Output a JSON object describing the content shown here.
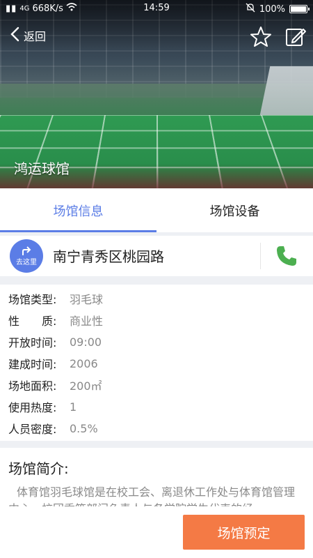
{
  "status_bar": {
    "network": "4G",
    "speed": "668K/s",
    "time": "14:59",
    "battery": "100%"
  },
  "header": {
    "back_label": "返回",
    "venue_name": "鸿运球馆"
  },
  "tabs": [
    {
      "label": "场馆信息",
      "active": true
    },
    {
      "label": "场馆设备",
      "active": false
    }
  ],
  "address": {
    "go_label": "去这里",
    "text": "南宁青秀区桃园路"
  },
  "details": [
    {
      "key": "场馆类型:",
      "value": "羽毛球"
    },
    {
      "key": "性　　质:",
      "value": "商业性"
    },
    {
      "key": "开放时间:",
      "value": "09:00"
    },
    {
      "key": "建成时间:",
      "value": "2006"
    },
    {
      "key": "场地面积:",
      "value": "200㎡"
    },
    {
      "key": "使用热度:",
      "value": "1"
    },
    {
      "key": "人员密度:",
      "value": "0.5%"
    }
  ],
  "intro": {
    "title": "场馆简介:",
    "body": "体育馆羽毛球馆是在校工会、离退休工作处与体育馆管理中心、校团委等部门负责人与各学院学生代表的经"
  },
  "book_button": "场馆预定",
  "colors": {
    "accent": "#5b7de6",
    "book": "#f47a45",
    "phone": "#4caf50"
  }
}
